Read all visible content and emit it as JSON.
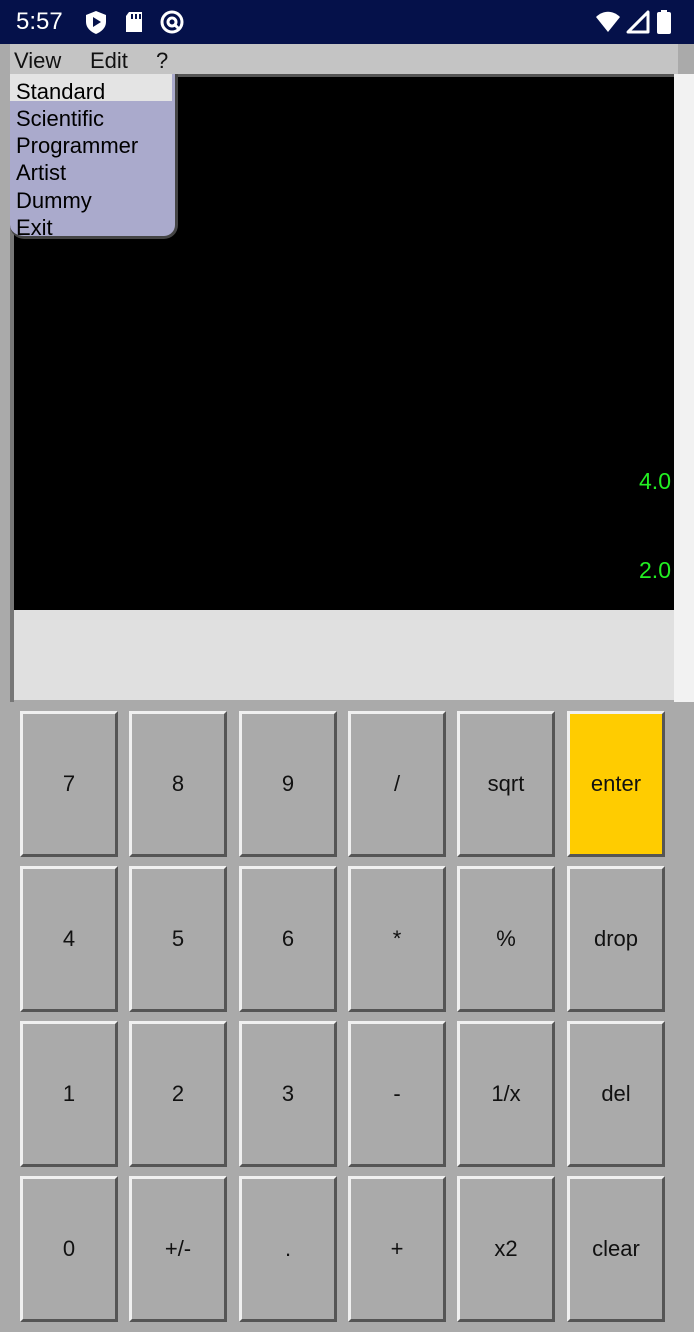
{
  "status_bar": {
    "time": "5:57",
    "background": "#05114a",
    "left_icons": [
      "play-protect-icon",
      "sd-card-icon",
      "data-saver-icon"
    ],
    "right_icons": [
      "wifi-icon",
      "signal-icon",
      "battery-icon"
    ]
  },
  "menu_bar": {
    "items": [
      {
        "label": "View"
      },
      {
        "label": "Edit"
      },
      {
        "label": "?"
      }
    ]
  },
  "view_menu": {
    "items": [
      {
        "label": "Standard",
        "highlighted": true
      },
      {
        "label": "Scientific"
      },
      {
        "label": "Programmer"
      },
      {
        "label": "Artist"
      },
      {
        "label": "Dummy"
      },
      {
        "label": "Exit"
      }
    ],
    "background": "#aaaacc"
  },
  "display": {
    "stack": [
      "4.0",
      "2.0"
    ],
    "text_color": "#22ee22",
    "input_value": ""
  },
  "keypad": {
    "accent": "#ffcc00",
    "rows": [
      [
        {
          "label": "7"
        },
        {
          "label": "8"
        },
        {
          "label": "9"
        },
        {
          "label": "/"
        },
        {
          "label": "sqrt"
        },
        {
          "label": "enter"
        }
      ],
      [
        {
          "label": "4"
        },
        {
          "label": "5"
        },
        {
          "label": "6"
        },
        {
          "label": "*"
        },
        {
          "label": "%"
        },
        {
          "label": "drop"
        }
      ],
      [
        {
          "label": "1"
        },
        {
          "label": "2"
        },
        {
          "label": "3"
        },
        {
          "label": "-"
        },
        {
          "label": "1/x"
        },
        {
          "label": "del"
        }
      ],
      [
        {
          "label": "0"
        },
        {
          "label": "+/-"
        },
        {
          "label": "."
        },
        {
          "label": "+"
        },
        {
          "label": "x2"
        },
        {
          "label": "clear"
        }
      ]
    ]
  }
}
